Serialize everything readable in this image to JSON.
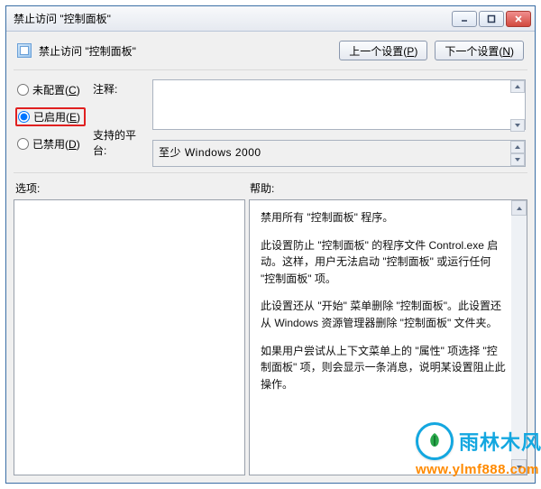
{
  "window": {
    "title": "禁止访问  \"控制面板\""
  },
  "header": {
    "title": "禁止访问  \"控制面板\"",
    "prev_btn": "上一个设置",
    "prev_hotkey": "P",
    "next_btn": "下一个设置",
    "next_hotkey": "N"
  },
  "radios": {
    "not_configured": "未配置",
    "not_configured_hotkey": "C",
    "enabled": "已启用",
    "enabled_hotkey": "E",
    "disabled": "已禁用",
    "disabled_hotkey": "D",
    "selected": "enabled"
  },
  "labels": {
    "comment": "注释:",
    "supported": "支持的平台:",
    "options": "选项:",
    "help": "帮助:"
  },
  "fields": {
    "comment_value": "",
    "supported_value": "至少 Windows 2000"
  },
  "help": {
    "p1": "禁用所有 \"控制面板\" 程序。",
    "p2": "此设置防止 \"控制面板\" 的程序文件 Control.exe 启动。这样，用户无法启动 \"控制面板\" 或运行任何 \"控制面板\" 项。",
    "p3": "此设置还从 \"开始\" 菜单删除 \"控制面板\"。此设置还从 Windows 资源管理器删除 \"控制面板\" 文件夹。",
    "p4": "如果用户尝试从上下文菜单上的 \"属性\" 项选择 \"控制面板\" 项，则会显示一条消息，说明某设置阻止此操作。"
  },
  "watermark": {
    "brand": "雨林木风",
    "url": "www.ylmf888.com"
  }
}
